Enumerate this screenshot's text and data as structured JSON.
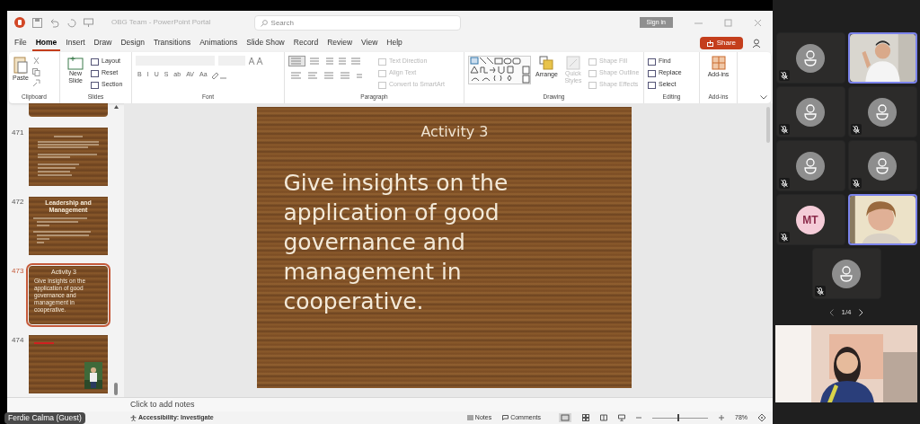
{
  "window": {
    "title": "OBG Team - PowerPoint Portal",
    "search_placeholder": "Search",
    "sign_in": "Sign in"
  },
  "menu_tabs": [
    {
      "label": "File",
      "selected": false
    },
    {
      "label": "Home",
      "selected": true
    },
    {
      "label": "Insert",
      "selected": false
    },
    {
      "label": "Draw",
      "selected": false
    },
    {
      "label": "Design",
      "selected": false
    },
    {
      "label": "Transitions",
      "selected": false
    },
    {
      "label": "Animations",
      "selected": false
    },
    {
      "label": "Slide Show",
      "selected": false
    },
    {
      "label": "Record",
      "selected": false
    },
    {
      "label": "Review",
      "selected": false
    },
    {
      "label": "View",
      "selected": false
    },
    {
      "label": "Help",
      "selected": false
    }
  ],
  "share_button": "Share",
  "ribbon": {
    "clipboard": {
      "label": "Clipboard",
      "paste": "Paste"
    },
    "slides": {
      "label": "Slides",
      "new_slide": "New Slide",
      "items": [
        {
          "label": "Layout",
          "disabled": false
        },
        {
          "label": "Reset",
          "disabled": false
        },
        {
          "label": "Section",
          "disabled": false
        }
      ]
    },
    "font": {
      "label": "Font",
      "buttons": [
        "B",
        "I",
        "U",
        "S",
        "ab",
        "AV",
        "Aa"
      ]
    },
    "paragraph": {
      "label": "Paragraph",
      "items": [
        {
          "label": "Text Direction",
          "disabled": true
        },
        {
          "label": "Align Text",
          "disabled": true
        },
        {
          "label": "Convert to SmartArt",
          "disabled": true
        }
      ]
    },
    "drawing": {
      "label": "Drawing",
      "arrange": "Arrange",
      "quick_styles": {
        "label": "Quick Styles",
        "disabled": true
      },
      "items": [
        {
          "label": "Shape Fill",
          "disabled": true
        },
        {
          "label": "Shape Outline",
          "disabled": true
        },
        {
          "label": "Shape Effects",
          "disabled": true
        }
      ]
    },
    "editing": {
      "label": "Editing",
      "items": [
        {
          "label": "Find",
          "disabled": false
        },
        {
          "label": "Replace",
          "disabled": false
        },
        {
          "label": "Select",
          "disabled": false
        }
      ]
    },
    "add_ins": {
      "label": "Add-ins",
      "button": "Add-ins"
    }
  },
  "thumbnails": [
    {
      "number": "471",
      "selected": false,
      "kind": "lines"
    },
    {
      "number": "472",
      "selected": false,
      "kind": "titled",
      "title": "Leadership and Management"
    },
    {
      "number": "473",
      "selected": true,
      "kind": "activity",
      "heading": "Activity 3",
      "body": "Give insights on the application of good governance and management in cooperative."
    },
    {
      "number": "474",
      "selected": false,
      "kind": "picture"
    }
  ],
  "slide": {
    "heading": "Activity 3",
    "body": "Give insights on the application of good governance and management in cooperative."
  },
  "notes_placeholder": "Click to add notes",
  "status_bar": {
    "accessibility": "Accessibility: Investigate",
    "notes": "Notes",
    "comments": "Comments",
    "zoom": "78%",
    "zoom_slider": {
      "level": 0.45
    }
  },
  "presenter_label": "Ferdie Calma (Guest)",
  "participants": [
    {
      "kind": "avatar",
      "muted": true,
      "speaking": false
    },
    {
      "kind": "video",
      "muted": false,
      "speaking": true
    },
    {
      "kind": "avatar",
      "muted": true,
      "speaking": false
    },
    {
      "kind": "avatar",
      "muted": true,
      "speaking": false
    },
    {
      "kind": "avatar",
      "muted": true,
      "speaking": false
    },
    {
      "kind": "avatar",
      "muted": true,
      "speaking": false
    },
    {
      "kind": "initials",
      "initials": "MT",
      "muted": true,
      "speaking": false
    },
    {
      "kind": "video",
      "muted": false,
      "speaking": true
    },
    {
      "kind": "avatar",
      "muted": true,
      "speaking": false
    }
  ],
  "pager": "1/4"
}
